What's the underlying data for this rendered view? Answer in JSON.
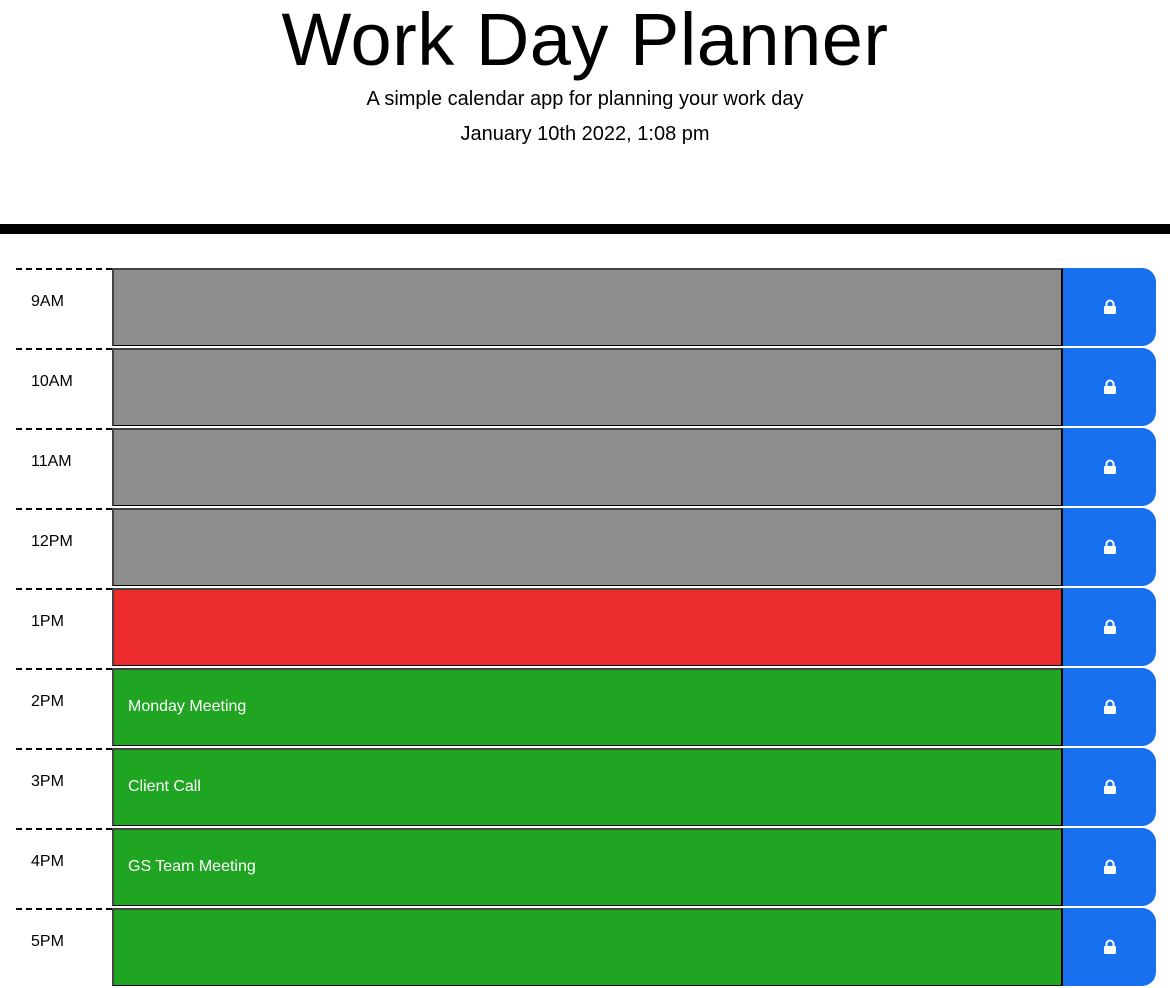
{
  "header": {
    "title": "Work Day Planner",
    "subtitle": "A simple calendar app for planning your work day",
    "date": "January 10th 2022, 1:08 pm"
  },
  "colors": {
    "past": "#8e8e8e",
    "present": "#ec2c2c",
    "future": "#1fa522",
    "save": "#1770ee"
  },
  "rows": [
    {
      "hour": "9AM",
      "text": "",
      "state": "past",
      "icon": "lock-icon"
    },
    {
      "hour": "10AM",
      "text": "",
      "state": "past",
      "icon": "lock-icon"
    },
    {
      "hour": "11AM",
      "text": "",
      "state": "past",
      "icon": "lock-icon"
    },
    {
      "hour": "12PM",
      "text": "",
      "state": "past",
      "icon": "lock-icon"
    },
    {
      "hour": "1PM",
      "text": "",
      "state": "present",
      "icon": "lock-icon"
    },
    {
      "hour": "2PM",
      "text": "Monday Meeting",
      "state": "future",
      "icon": "lock-icon"
    },
    {
      "hour": "3PM",
      "text": "Client Call",
      "state": "future",
      "icon": "lock-icon"
    },
    {
      "hour": "4PM",
      "text": "GS Team Meeting",
      "state": "future",
      "icon": "lock-icon"
    },
    {
      "hour": "5PM",
      "text": "",
      "state": "future",
      "icon": "lock-icon"
    }
  ]
}
